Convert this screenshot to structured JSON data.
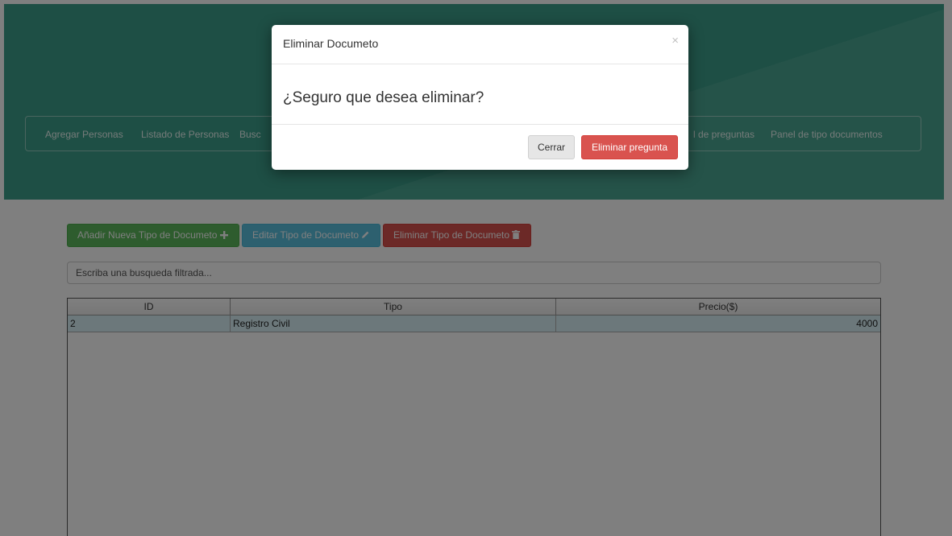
{
  "nav": {
    "items": [
      "Agregar Personas",
      "Listado de Personas",
      "Busc",
      "l de preguntas",
      "Panel de tipo documentos"
    ]
  },
  "toolbar": {
    "add_label": "Añadir Nueva Tipo de Documeto",
    "add_icon": "plus-icon",
    "edit_label": "Editar Tipo de Documeto",
    "edit_icon": "pencil-icon",
    "delete_label": "Eliminar Tipo de Documeto",
    "delete_icon": "trash-icon"
  },
  "search": {
    "placeholder": "Escriba una busqueda filtrada..."
  },
  "table": {
    "columns": [
      "ID",
      "Tipo",
      "Precio($)"
    ],
    "rows": [
      {
        "id": "2",
        "tipo": "Registro Civil",
        "precio": "4000"
      }
    ]
  },
  "modal": {
    "title": "Eliminar Documeto",
    "close_icon": "×",
    "message": "¿Seguro que desea eliminar?",
    "close_button": "Cerrar",
    "delete_button": "Eliminar pregunta"
  },
  "colors": {
    "header": "#3d9f8a",
    "success": "#5cb85c",
    "info": "#5bc0de",
    "danger": "#d9534f"
  }
}
